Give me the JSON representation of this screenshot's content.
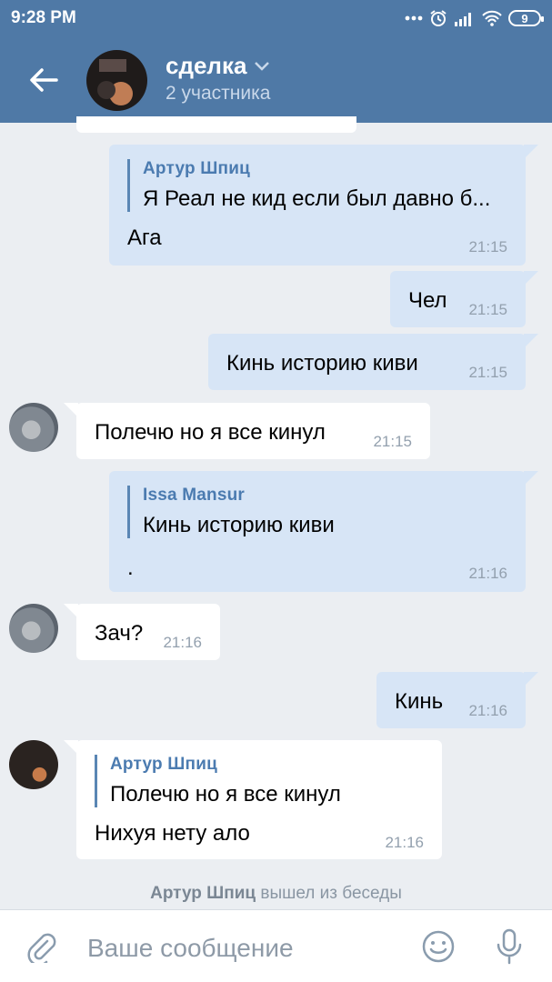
{
  "status": {
    "time": "9:28 PM",
    "battery": "9"
  },
  "header": {
    "title": "сделка",
    "subtitle": "2 участника"
  },
  "messages": [
    {
      "id": "m1",
      "reply_name": "Артур Шпиц",
      "reply_text": "Я Реал не кид если был давно б...",
      "text": "Ага",
      "time": "21:15"
    },
    {
      "id": "m2",
      "text": "Чел",
      "time": "21:15"
    },
    {
      "id": "m3",
      "text": "Кинь историю киви",
      "time": "21:15"
    },
    {
      "id": "m4",
      "text": "Полечю но я все кинул",
      "time": "21:15"
    },
    {
      "id": "m5",
      "reply_name": "Issa Mansur",
      "reply_text": "Кинь историю киви",
      "text": ".",
      "time": "21:16"
    },
    {
      "id": "m6",
      "text": "Зач?",
      "time": "21:16"
    },
    {
      "id": "m7",
      "text": "Кинь",
      "time": "21:16"
    },
    {
      "id": "m8",
      "reply_name": "Артур Шпиц",
      "reply_text": "Полечю но я все кинул",
      "text": "Нихуя нету ало",
      "time": "21:16"
    }
  ],
  "service": {
    "name": "Артур Шпиц",
    "action": "вышел из беседы"
  },
  "composer": {
    "placeholder": "Ваше сообщение"
  },
  "colors": {
    "header": "#4f79a6",
    "outgoing": "#d7e5f6",
    "incoming": "#ffffff",
    "background": "#ebeef2",
    "reply_name": "#4b7bb0"
  },
  "icons": [
    "back-arrow-icon",
    "chevron-down-icon",
    "attach-icon",
    "emoji-icon",
    "microphone-icon"
  ]
}
